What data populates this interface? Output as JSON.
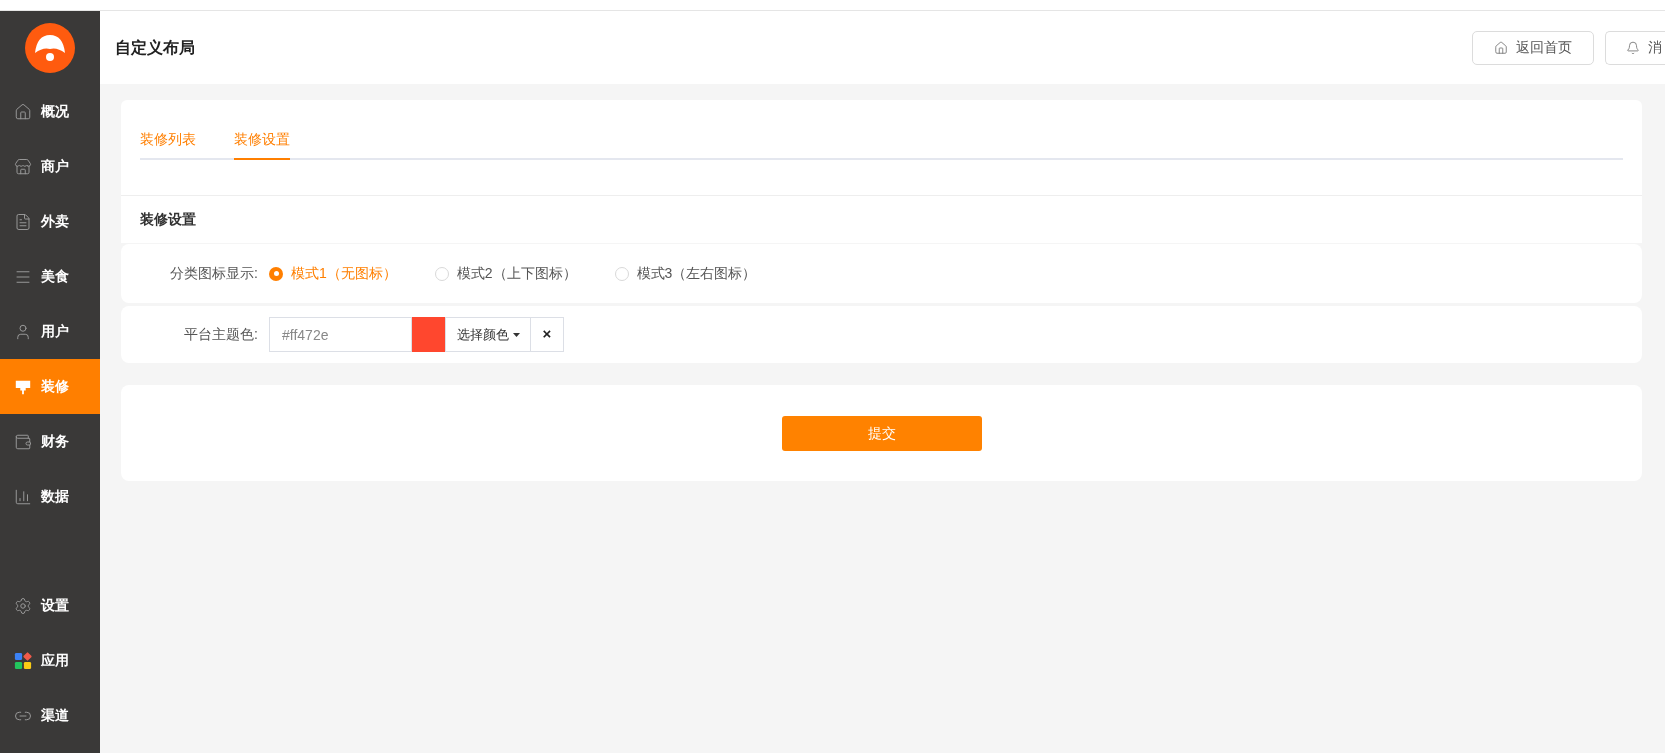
{
  "sidebar": {
    "items": [
      {
        "label": "概况",
        "selected": false
      },
      {
        "label": "商户",
        "selected": false
      },
      {
        "label": "外卖",
        "selected": false
      },
      {
        "label": "美食",
        "selected": false
      },
      {
        "label": "用户",
        "selected": false
      },
      {
        "label": "装修",
        "selected": true
      },
      {
        "label": "财务",
        "selected": false
      },
      {
        "label": "数据",
        "selected": false
      }
    ],
    "bottom_items": [
      {
        "label": "设置",
        "selected": false
      },
      {
        "label": "应用",
        "selected": false
      },
      {
        "label": "渠道",
        "selected": false
      }
    ]
  },
  "header": {
    "title": "自定义布局",
    "buttons": [
      "返回首页",
      "消"
    ]
  },
  "tabs": [
    {
      "label": "装修列表",
      "selected": false
    },
    {
      "label": "装修设置",
      "selected": true
    }
  ],
  "section_title": "装修设置",
  "icon_display": {
    "label": "分类图标显示:",
    "options": [
      {
        "label": "模式1（无图标）",
        "selected": true
      },
      {
        "label": "模式2（上下图标）",
        "selected": false
      },
      {
        "label": "模式3（左右图标）",
        "selected": false
      }
    ]
  },
  "theme_color": {
    "label": "平台主题色:",
    "value": "#ff472e",
    "color": "#ff472e",
    "picker_label": "选择颜色",
    "clear_label": "×"
  },
  "submit": "提交"
}
